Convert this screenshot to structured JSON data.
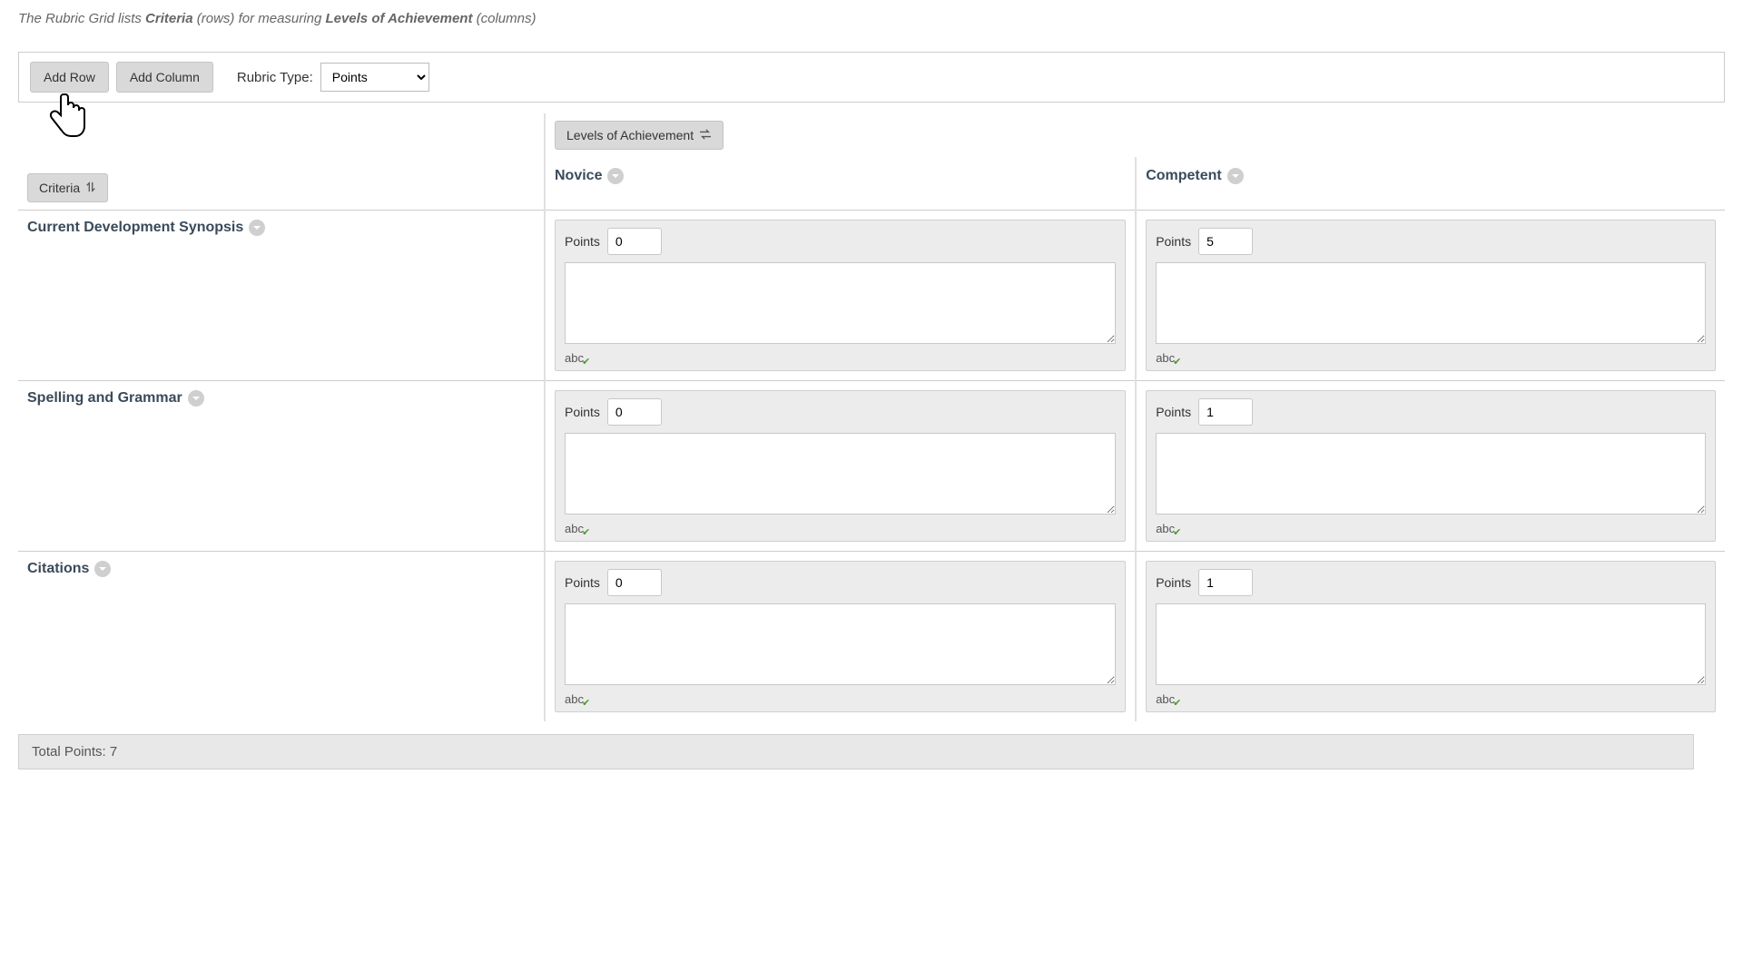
{
  "intro": {
    "p1": "The Rubric Grid lists ",
    "b1": "Criteria",
    "p2": " (rows) for measuring ",
    "b2": "Levels of Achievement",
    "p3": " (columns)"
  },
  "toolbar": {
    "add_row": "Add Row",
    "add_column": "Add Column",
    "rubric_type_label": "Rubric Type:",
    "rubric_type_value": "Points"
  },
  "chips": {
    "criteria": "Criteria",
    "levels": "Levels of Achievement"
  },
  "columns": [
    {
      "title": "Novice"
    },
    {
      "title": "Competent"
    }
  ],
  "rows": [
    {
      "title": "Current Development Synopsis",
      "cells": [
        {
          "points": "0"
        },
        {
          "points": "5"
        }
      ]
    },
    {
      "title": "Spelling and Grammar",
      "cells": [
        {
          "points": "0"
        },
        {
          "points": "1"
        }
      ]
    },
    {
      "title": "Citations",
      "cells": [
        {
          "points": "0"
        },
        {
          "points": "1"
        }
      ]
    }
  ],
  "labels": {
    "points": "Points",
    "abc": "abc"
  },
  "total": "Total Points: 7"
}
